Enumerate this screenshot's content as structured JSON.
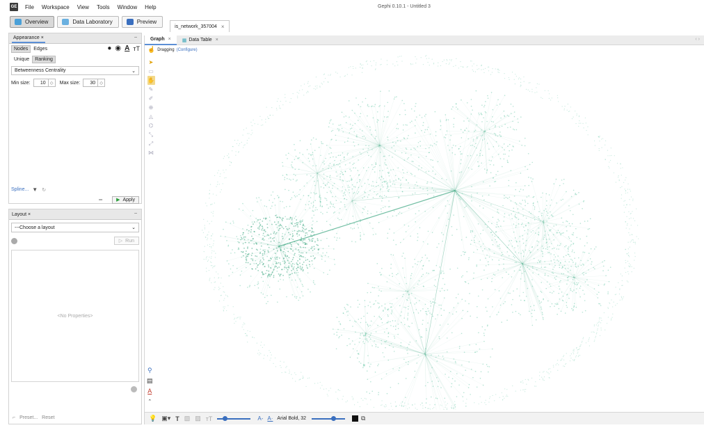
{
  "menu": {
    "logo": "GE",
    "items": [
      "File",
      "Workspace",
      "View",
      "Tools",
      "Window",
      "Help"
    ],
    "window_title": "Gephi 0.10.1 - Untitled 3"
  },
  "toolbar": {
    "overview": "Overview",
    "data_lab": "Data Laboratory",
    "preview": "Preview",
    "doc_tab": "is_network_357004"
  },
  "appearance": {
    "title": "Appearance",
    "nodes": "Nodes",
    "edges": "Edges",
    "unique": "Unique",
    "ranking": "Ranking",
    "metric": "Betweenness Centrality",
    "min_label": "Min size:",
    "min_value": "10",
    "max_label": "Max size:",
    "max_value": "30",
    "spline": "Spline...",
    "apply": "Apply"
  },
  "layout": {
    "title": "Layout",
    "choose": "---Choose a layout",
    "run": "Run",
    "no_properties": "<No Properties>",
    "preset": "Preset...",
    "reset": "Reset"
  },
  "graph": {
    "tab_graph": "Graph",
    "tab_table": "Data Table",
    "dragging": "Dragging",
    "configure": "(Configure)",
    "font_label": "Arial Bold, 32"
  },
  "colors": {
    "node": "#5cc4a0",
    "edge": "#3aa57f"
  }
}
